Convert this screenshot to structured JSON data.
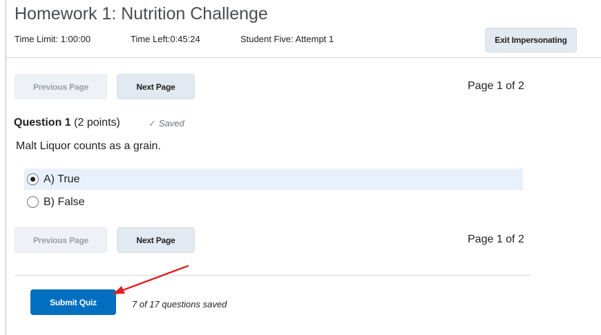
{
  "quiz": {
    "title": "Homework 1: Nutrition Challenge",
    "time_limit": "Time Limit: 1:00:00",
    "time_left": "Time Left:0:45:24",
    "student_attempt": "Student Five: Attempt 1",
    "exit_button": "Exit Impersonating"
  },
  "pagination_top": {
    "previous_label": "Previous Page",
    "next_label": "Next Page",
    "page_indicator": "Page 1 of 2"
  },
  "question": {
    "number": "Question 1",
    "points": "(2 points)",
    "saved_label": "Saved",
    "text": "Malt Liquor counts as a grain.",
    "options": [
      {
        "label": "A) True",
        "selected": true
      },
      {
        "label": "B) False",
        "selected": false
      }
    ]
  },
  "pagination_bottom": {
    "previous_label": "Previous Page",
    "next_label": "Next Page",
    "page_indicator": "Page 1 of 2"
  },
  "footer": {
    "submit_label": "Submit Quiz",
    "saved_status": "7 of 17 questions saved"
  },
  "colors": {
    "primary": "#006fbf",
    "selected_option_bg": "#e8f1fb",
    "annotation_arrow": "#e02020"
  },
  "icons": {
    "saved": "checkmark-icon",
    "annotation": "red-arrow-annotation"
  }
}
